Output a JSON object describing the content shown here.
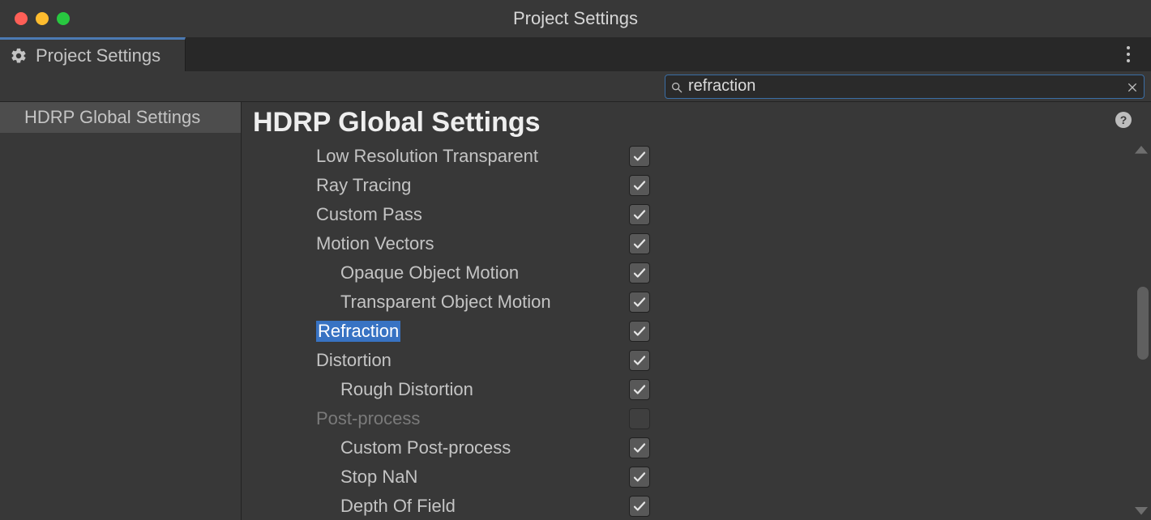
{
  "window": {
    "title": "Project Settings"
  },
  "tab": {
    "label": "Project Settings"
  },
  "search": {
    "value": "refraction"
  },
  "sidebar": {
    "items": [
      {
        "label": "HDRP Global Settings"
      }
    ]
  },
  "page": {
    "title": "HDRP Global Settings"
  },
  "settings": [
    {
      "label": "Low Resolution Transparent",
      "indent": 1,
      "checked": true,
      "disabled": false,
      "highlight": false
    },
    {
      "label": "Ray Tracing",
      "indent": 1,
      "checked": true,
      "disabled": false,
      "highlight": false
    },
    {
      "label": "Custom Pass",
      "indent": 1,
      "checked": true,
      "disabled": false,
      "highlight": false
    },
    {
      "label": "Motion Vectors",
      "indent": 1,
      "checked": true,
      "disabled": false,
      "highlight": false
    },
    {
      "label": "Opaque Object Motion",
      "indent": 2,
      "checked": true,
      "disabled": false,
      "highlight": false
    },
    {
      "label": "Transparent Object Motion",
      "indent": 2,
      "checked": true,
      "disabled": false,
      "highlight": false
    },
    {
      "label": "Refraction",
      "indent": 1,
      "checked": true,
      "disabled": false,
      "highlight": true
    },
    {
      "label": "Distortion",
      "indent": 1,
      "checked": true,
      "disabled": false,
      "highlight": false
    },
    {
      "label": "Rough Distortion",
      "indent": 2,
      "checked": true,
      "disabled": false,
      "highlight": false
    },
    {
      "label": "Post-process",
      "indent": 1,
      "checked": false,
      "disabled": true,
      "highlight": false
    },
    {
      "label": "Custom Post-process",
      "indent": 2,
      "checked": true,
      "disabled": false,
      "highlight": false
    },
    {
      "label": "Stop NaN",
      "indent": 2,
      "checked": true,
      "disabled": false,
      "highlight": false
    },
    {
      "label": "Depth Of Field",
      "indent": 2,
      "checked": true,
      "disabled": false,
      "highlight": false
    }
  ]
}
